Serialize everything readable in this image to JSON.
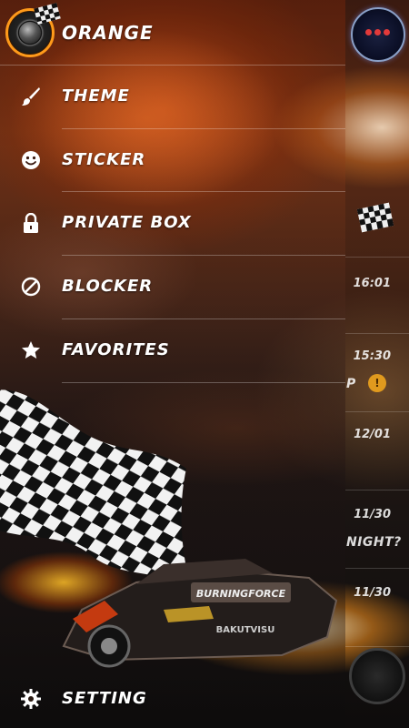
{
  "drawer": {
    "app_name": "ORANGE",
    "menu": [
      {
        "label": "THEME",
        "icon": "brush-icon"
      },
      {
        "label": "STICKER",
        "icon": "smiley-icon"
      },
      {
        "label": "PRIVATE BOX",
        "icon": "lock-icon"
      },
      {
        "label": "BLOCKER",
        "icon": "block-icon"
      },
      {
        "label": "FAVORITES",
        "icon": "star-icon"
      }
    ],
    "setting_label": "SETTING"
  },
  "conversation_list": {
    "times": [
      "16:01",
      "15:30",
      "12/01",
      "11/30",
      "11/30"
    ],
    "snippets": [
      "P",
      "NIGHT?"
    ],
    "unread_badge": "!"
  },
  "colors": {
    "accent": "#ff9a1a",
    "badge": "#e09a1e",
    "text": "#ffffff"
  }
}
